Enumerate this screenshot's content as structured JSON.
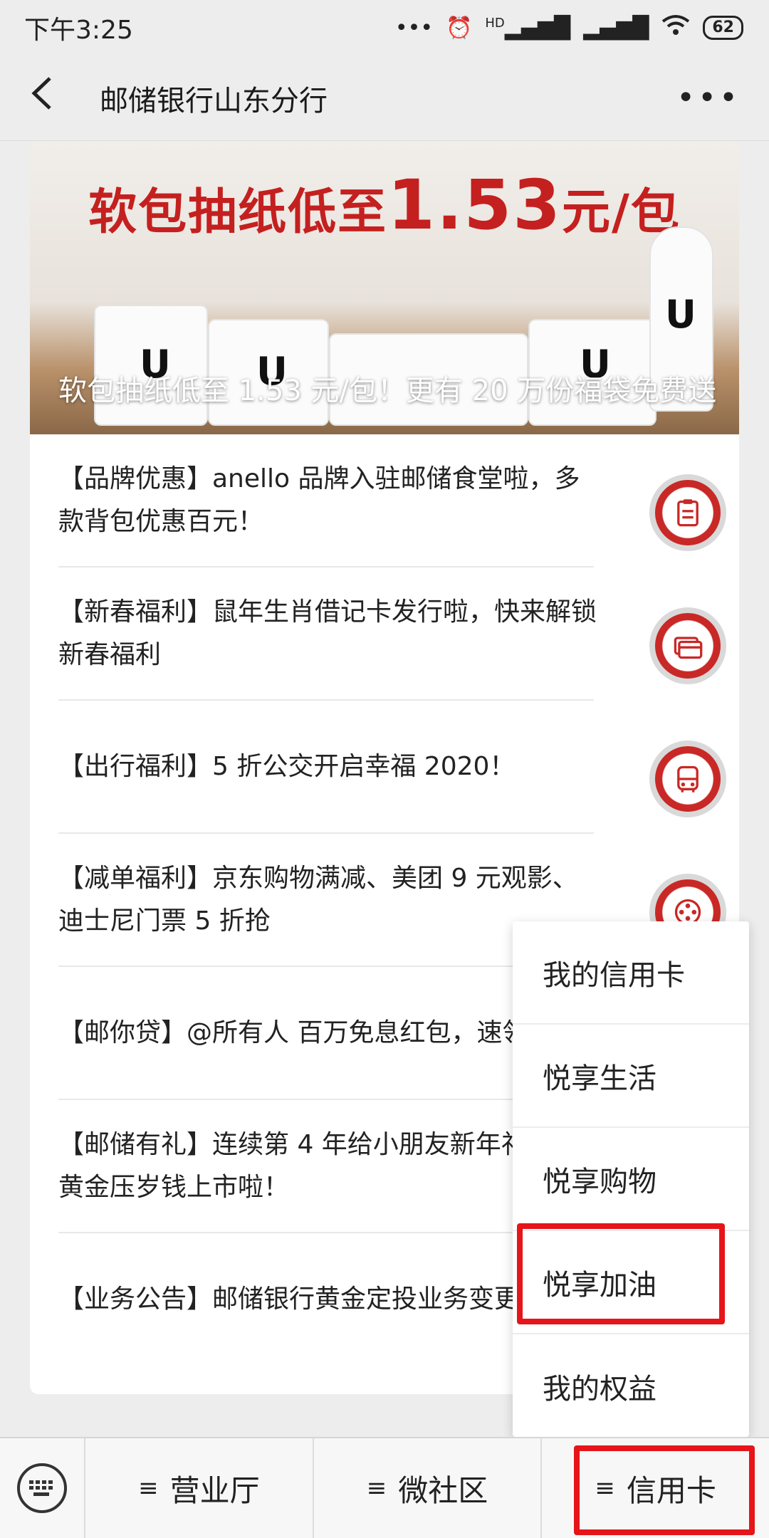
{
  "status_bar": {
    "time": "下午3:25",
    "signal_label": "HD",
    "battery": "62"
  },
  "nav": {
    "title": "邮储银行山东分行"
  },
  "banner": {
    "headline_prefix": "软包抽纸低至",
    "headline_price": "1.53",
    "headline_suffix": "元/包",
    "caption": "软包抽纸低至 1.53 元/包！更有 20 万份福袋免费送"
  },
  "articles": [
    {
      "title": "【品牌优惠】anello 品牌入驻邮储食堂啦，多款背包优惠百元！",
      "icon": "clipboard-icon"
    },
    {
      "title": "【新春福利】鼠年生肖借记卡发行啦，快来解锁新春福利",
      "icon": "card-icon"
    },
    {
      "title": "【出行福利】5 折公交开启幸福 2020！",
      "icon": "bus-icon"
    },
    {
      "title": "【减单福利】京东购物满减、美团 9 元观影、迪士尼门票 5 折抢",
      "icon": "film-icon"
    },
    {
      "title": "【邮你贷】@所有人 百万免息红包，速领",
      "icon": ""
    },
    {
      "title": "【邮储有礼】连续第 4 年给小朋友新年礼 故宫黄金压岁钱上市啦！",
      "icon": ""
    },
    {
      "title": "【业务公告】邮储银行黄金定投业务变更公告",
      "icon": ""
    }
  ],
  "popup_menu": {
    "items": [
      "我的信用卡",
      "悦享生活",
      "悦享购物",
      "悦享加油",
      "我的权益"
    ],
    "highlighted_index": 3
  },
  "bottom_menu": {
    "items": [
      "营业厅",
      "微社区",
      "信用卡"
    ],
    "highlighted_index": 2,
    "hamburger": "≡"
  },
  "colors": {
    "accent_red": "#c82826",
    "highlight_red": "#e5151a"
  }
}
